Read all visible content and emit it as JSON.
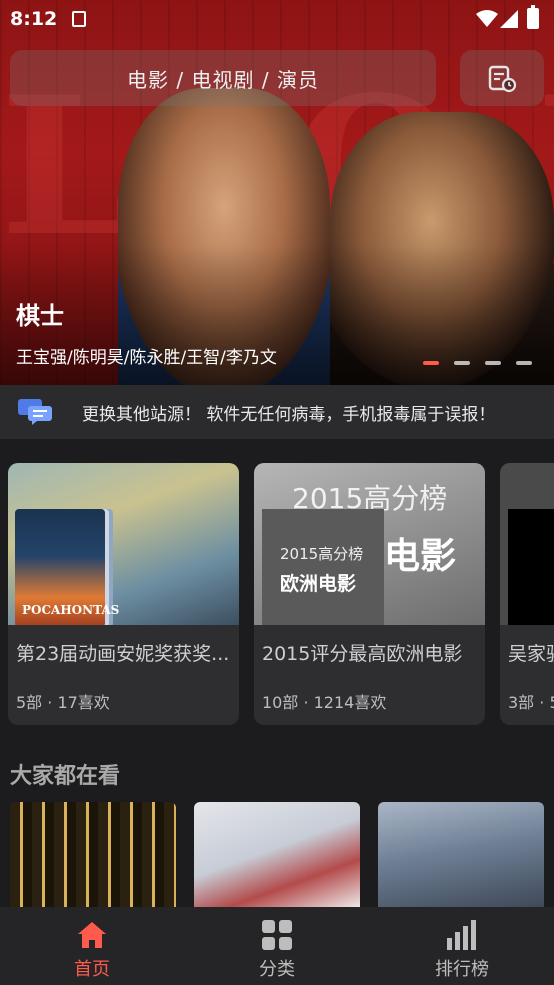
{
  "status": {
    "time": "8:12"
  },
  "search": {
    "placeholder": "电影 / 电视剧 / 演员"
  },
  "hero": {
    "bg_text": "LAO NG S",
    "title": "棋士",
    "cast": "王宝强/陈明昊/陈永胜/王智/李乃文",
    "pages": 4,
    "active_page": 1
  },
  "notice": {
    "text": "更换其他站源！ 软件无任何病毒，手机报毒属于误报！"
  },
  "collections": [
    {
      "name": "第23届动画安妮奖获奖...",
      "meta": "5部 · 17喜欢",
      "cover_text": "POCAHONTAS"
    },
    {
      "name": "2015评分最高欧洲电影",
      "meta": "10部 · 1214喜欢",
      "cover_big": "2015高分榜",
      "cover_small": "2015高分榜",
      "cover_sub": "欧洲电影",
      "cover_tail": "电影"
    },
    {
      "name": "吴家骏",
      "meta": "3部 · 5"
    }
  ],
  "section": {
    "title": "大家都在看"
  },
  "tabs": [
    {
      "label": "首页",
      "icon": "home-icon",
      "active": true
    },
    {
      "label": "分类",
      "icon": "grid-icon",
      "active": false
    },
    {
      "label": "排行榜",
      "icon": "bar-chart-icon",
      "active": false
    }
  ],
  "colors": {
    "accent": "#ff5a4e",
    "background": "#1c1c1e",
    "card": "#2e2e30"
  }
}
